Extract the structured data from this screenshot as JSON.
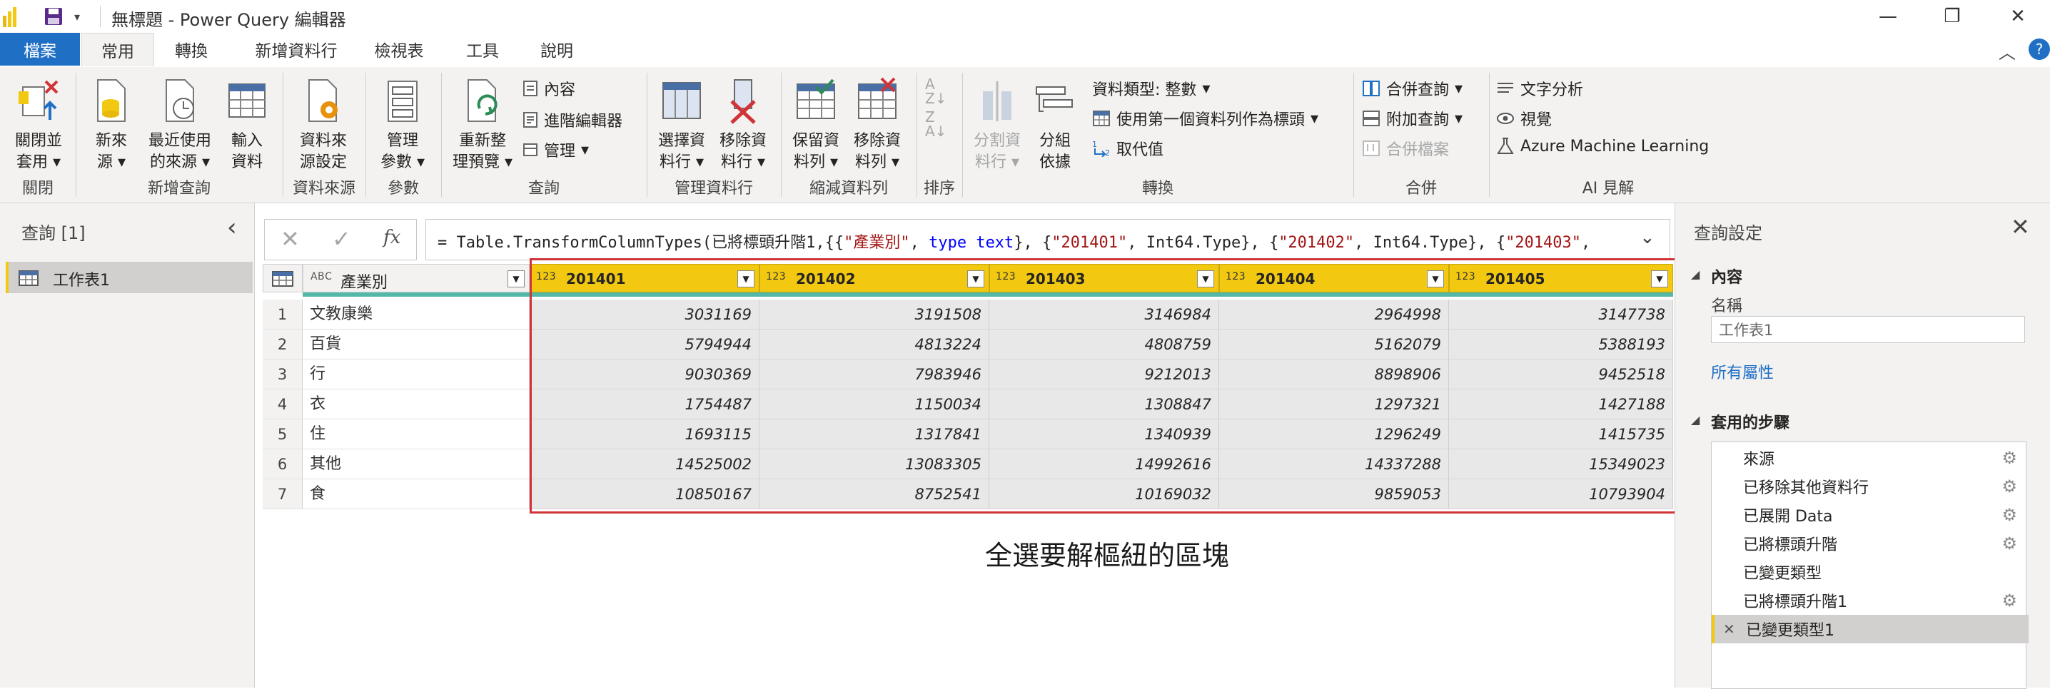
{
  "window": {
    "title": "無標題 - Power Query 編輯器",
    "minimize": "—",
    "restore": "❐",
    "close": "✕"
  },
  "menu": {
    "tabs": [
      "檔案",
      "常用",
      "轉換",
      "新增資料行",
      "檢視表",
      "工具",
      "說明"
    ]
  },
  "ribbon": {
    "close_apply": [
      "關閉並",
      "套用"
    ],
    "new_source": [
      "新來",
      "源"
    ],
    "recent_sources": [
      "最近使用",
      "的來源"
    ],
    "enter_data": [
      "輸入",
      "資料"
    ],
    "data_source_settings": [
      "資料來",
      "源設定"
    ],
    "manage_params": [
      "管理",
      "參數"
    ],
    "refresh_preview": [
      "重新整",
      "理預覽"
    ],
    "properties": "內容",
    "advanced_editor": "進階編輯器",
    "manage": "管理",
    "choose_columns": [
      "選擇資",
      "料行"
    ],
    "remove_columns": [
      "移除資",
      "料行"
    ],
    "keep_rows": [
      "保留資",
      "料列"
    ],
    "remove_rows": [
      "移除資",
      "料列"
    ],
    "split_column": [
      "分割資",
      "料行"
    ],
    "group_by": [
      "分組",
      "依據"
    ],
    "data_type": "資料類型: 整數",
    "use_first_row": "使用第一個資料列作為標頭",
    "replace_values": "取代值",
    "merge_queries": "合併查詢",
    "append_queries": "附加查詢",
    "combine_files": "合併檔案",
    "text_analytics": "文字分析",
    "vision": "視覺",
    "azure_ml": "Azure Machine Learning",
    "groups": [
      "關閉",
      "新增查詢",
      "資料來源",
      "參數",
      "查詢",
      "管理資料行",
      "縮減資料列",
      "排序",
      "轉換",
      "合併",
      "AI 見解"
    ]
  },
  "left_pane": {
    "title": "查詢 [1]",
    "collapse_glyph": "‹",
    "query_name": "工作表1"
  },
  "formula": {
    "fx": "fx",
    "text_prefix": "= Table.TransformColumnTypes(已將標頭升階1,{{",
    "s1": "\"產業別\"",
    "t1": ", ",
    "kw1": "type text",
    "t2": "}, {",
    "s2": "\"201401\"",
    "t3": ", Int64.Type}, {",
    "s3": "\"201402\"",
    "t4": ", Int64.Type}, {",
    "s4": "\"201403\"",
    "t5": ","
  },
  "grid": {
    "first_col_header": "產業別",
    "type_abc": "A B C",
    "type_int": "1 2 3",
    "columns": [
      "201401",
      "201402",
      "201403",
      "201404",
      "201405"
    ],
    "rows": [
      {
        "n": "1",
        "label": "文教康樂",
        "v": [
          "3031169",
          "3191508",
          "3146984",
          "2964998",
          "3147738"
        ]
      },
      {
        "n": "2",
        "label": "百貨",
        "v": [
          "5794944",
          "4813224",
          "4808759",
          "5162079",
          "5388193"
        ]
      },
      {
        "n": "3",
        "label": "行",
        "v": [
          "9030369",
          "7983946",
          "9212013",
          "8898906",
          "9452518"
        ]
      },
      {
        "n": "4",
        "label": "衣",
        "v": [
          "1754487",
          "1150034",
          "1308847",
          "1297321",
          "1427188"
        ]
      },
      {
        "n": "5",
        "label": "住",
        "v": [
          "1693115",
          "1317841",
          "1340939",
          "1296249",
          "1415735"
        ]
      },
      {
        "n": "6",
        "label": "其他",
        "v": [
          "14525002",
          "13083305",
          "14992616",
          "14337288",
          "15349023"
        ]
      },
      {
        "n": "7",
        "label": "食",
        "v": [
          "10850167",
          "8752541",
          "10169032",
          "9859053",
          "10793904"
        ]
      }
    ]
  },
  "annotation": "全選要解樞紐的區塊",
  "right_pane": {
    "title": "查詢設定",
    "properties_header": "內容",
    "name_label": "名稱",
    "name_value": "工作表1",
    "all_properties": "所有屬性",
    "steps_header": "套用的步驟",
    "steps": [
      {
        "label": "來源",
        "gear": true
      },
      {
        "label": "已移除其他資料行",
        "gear": true
      },
      {
        "label": "已展開 Data",
        "gear": true
      },
      {
        "label": "已將標頭升階",
        "gear": true
      },
      {
        "label": "已變更類型",
        "gear": false
      },
      {
        "label": "已將標頭升階1",
        "gear": true
      },
      {
        "label": "已變更類型1",
        "gear": false,
        "selected": true
      }
    ]
  },
  "colors": {
    "accent_blue": "#1f6fc5",
    "header_yellow": "#f2c811",
    "highlight_red": "#d13438",
    "teal_bar": "#53b8a7"
  }
}
